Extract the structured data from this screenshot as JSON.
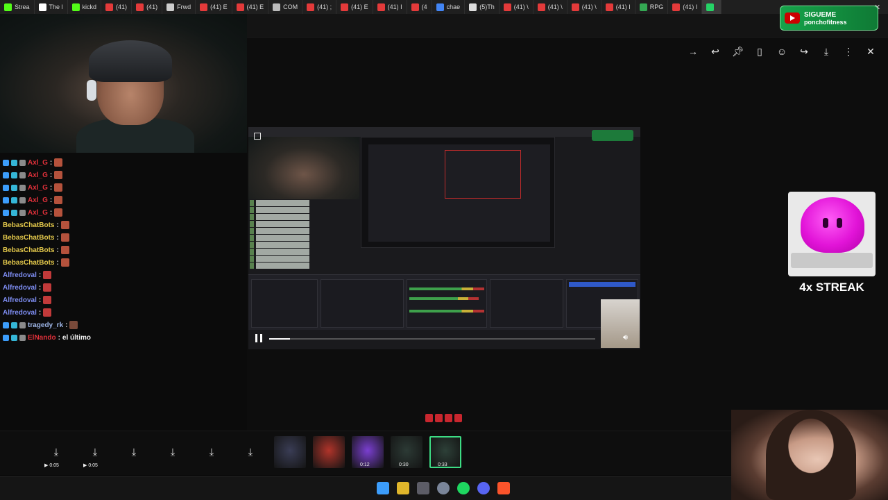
{
  "browser": {
    "tabs": [
      {
        "label": "Strea",
        "color": "#53fc18",
        "active": false
      },
      {
        "label": "The l",
        "color": "#ffffff",
        "active": false
      },
      {
        "label": "kickd",
        "color": "#53fc18",
        "active": false
      },
      {
        "label": "(41)",
        "color": "#e33a3a",
        "active": false
      },
      {
        "label": "(41)",
        "color": "#e33a3a",
        "active": false
      },
      {
        "label": "Frwd",
        "color": "#cccccc",
        "active": false
      },
      {
        "label": "(41) E",
        "color": "#e33a3a",
        "active": false
      },
      {
        "label": "(41) E",
        "color": "#e33a3a",
        "active": false
      },
      {
        "label": "COM",
        "color": "#bbbbbb",
        "active": false
      },
      {
        "label": "(41) ;",
        "color": "#e33a3a",
        "active": false
      },
      {
        "label": "(41) E",
        "color": "#e33a3a",
        "active": false
      },
      {
        "label": "(41) I",
        "color": "#e33a3a",
        "active": false
      },
      {
        "label": "(4",
        "color": "#e33a3a",
        "active": false
      },
      {
        "label": "chae",
        "color": "#4285f4",
        "active": false
      },
      {
        "label": "(5)Th",
        "color": "#dddddd",
        "active": false
      },
      {
        "label": "(41) \\",
        "color": "#e33a3a",
        "active": false
      },
      {
        "label": "(41) \\",
        "color": "#e33a3a",
        "active": false
      },
      {
        "label": "(41) \\",
        "color": "#e33a3a",
        "active": false
      },
      {
        "label": "(41) I",
        "color": "#e33a3a",
        "active": false
      },
      {
        "label": "RPG",
        "color": "#34a853",
        "active": false
      },
      {
        "label": "(41) I",
        "color": "#e33a3a",
        "active": false
      },
      {
        "label": "",
        "color": "#25d366",
        "active": true
      }
    ],
    "window_controls": {
      "minimize": "—",
      "close": "✕"
    }
  },
  "sigueme": {
    "line1": "SIGUEME",
    "line2": "ponchofitness"
  },
  "chat": {
    "messages": [
      {
        "user": "Axl_G",
        "sep": ":",
        "text": "",
        "user_color": "#e0303a"
      },
      {
        "user": "Axl_G",
        "sep": ":",
        "text": "",
        "user_color": "#e0303a"
      },
      {
        "user": "Axl_G",
        "sep": ":",
        "text": "",
        "user_color": "#e0303a"
      },
      {
        "user": "Axl_G",
        "sep": ":",
        "text": "",
        "user_color": "#e0303a"
      },
      {
        "user": "Axl_G",
        "sep": ":",
        "text": "",
        "user_color": "#e0303a"
      },
      {
        "user": "BebasChatBots",
        "sep": ":",
        "text": "",
        "user_color": "#e3c84b"
      },
      {
        "user": "BebasChatBots",
        "sep": ":",
        "text": "",
        "user_color": "#e3c84b"
      },
      {
        "user": "BebasChatBots",
        "sep": ":",
        "text": "",
        "user_color": "#e3c84b"
      },
      {
        "user": "BebasChatBots",
        "sep": ":",
        "text": "",
        "user_color": "#e3c84b"
      },
      {
        "user": "Alfredoval",
        "sep": ":",
        "text": "",
        "user_color": "#7d8cf0"
      },
      {
        "user": "Alfredoval",
        "sep": ":",
        "text": "",
        "user_color": "#7d8cf0"
      },
      {
        "user": "Alfredoval",
        "sep": ":",
        "text": "",
        "user_color": "#7d8cf0"
      },
      {
        "user": "Alfredoval",
        "sep": ":",
        "text": "",
        "user_color": "#7d8cf0"
      },
      {
        "user": "tragedy_rk",
        "sep": ":",
        "text": "",
        "user_color": "#9fb7e8"
      },
      {
        "user": "ElNando",
        "sep": ":",
        "text": "el último",
        "user_color": "#e0303a"
      }
    ]
  },
  "viewer": {
    "icons": [
      "arrow-right-icon",
      "reply-icon",
      "pin-icon",
      "bookmark-icon",
      "emoji-icon",
      "share-icon",
      "download-icon",
      "more-icon",
      "close-icon"
    ]
  },
  "streak": {
    "label": "4x STREAK"
  },
  "media_strip": {
    "downloads": [
      {
        "duration": "0:05"
      },
      {
        "duration": "0:05"
      },
      {
        "duration": ""
      },
      {
        "duration": ""
      },
      {
        "duration": ""
      },
      {
        "duration": ""
      }
    ],
    "thumbnails": [
      {
        "duration": "",
        "color": "#3a3d55"
      },
      {
        "duration": "",
        "color": "#b0342a"
      },
      {
        "duration": "0:12",
        "color": "#7a3fd0"
      },
      {
        "duration": "0:30",
        "color": "#2c3a35"
      },
      {
        "duration": "0:33",
        "color": "#2d4038",
        "selected": true
      }
    ]
  },
  "taskbar": {
    "apps": [
      {
        "name": "windows-start-icon",
        "color": "#3c9dfb"
      },
      {
        "name": "chrome-icon",
        "color": "#e0b62b"
      },
      {
        "name": "obs-icon",
        "color": "#5c5c66"
      },
      {
        "name": "steam-icon",
        "color": "#7a8599"
      },
      {
        "name": "spotify-icon",
        "color": "#1ed760"
      },
      {
        "name": "discord-icon",
        "color": "#5865f2"
      },
      {
        "name": "brave-icon",
        "color": "#fb542b"
      }
    ]
  }
}
